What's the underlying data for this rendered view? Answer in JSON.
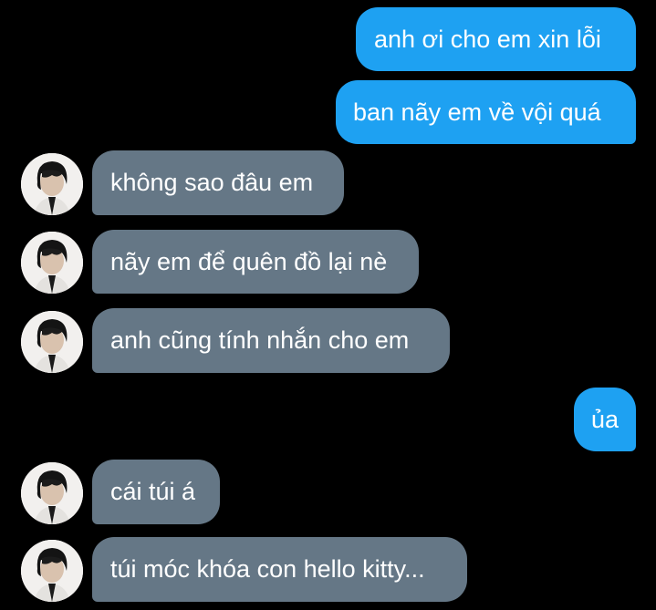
{
  "conversation": {
    "messages": [
      {
        "sender": "me",
        "text": "anh ơi cho em xin lỗi"
      },
      {
        "sender": "me",
        "text": "ban nãy em về vội quá"
      },
      {
        "sender": "contact",
        "text": "không sao đâu em"
      },
      {
        "sender": "contact",
        "text": "nãy em để quên đồ lại nè"
      },
      {
        "sender": "contact",
        "text": "anh cũng tính nhắn cho em"
      },
      {
        "sender": "me",
        "text": "ủa"
      },
      {
        "sender": "contact",
        "text": "cái túi á"
      },
      {
        "sender": "contact",
        "text": "túi móc khóa con hello kitty..."
      }
    ]
  },
  "colors": {
    "background": "#000000",
    "outgoing_bubble": "#1ea1f2",
    "incoming_bubble": "#657786",
    "text": "#ffffff"
  },
  "icons": {
    "contact_avatar": "contact-avatar-photo"
  }
}
